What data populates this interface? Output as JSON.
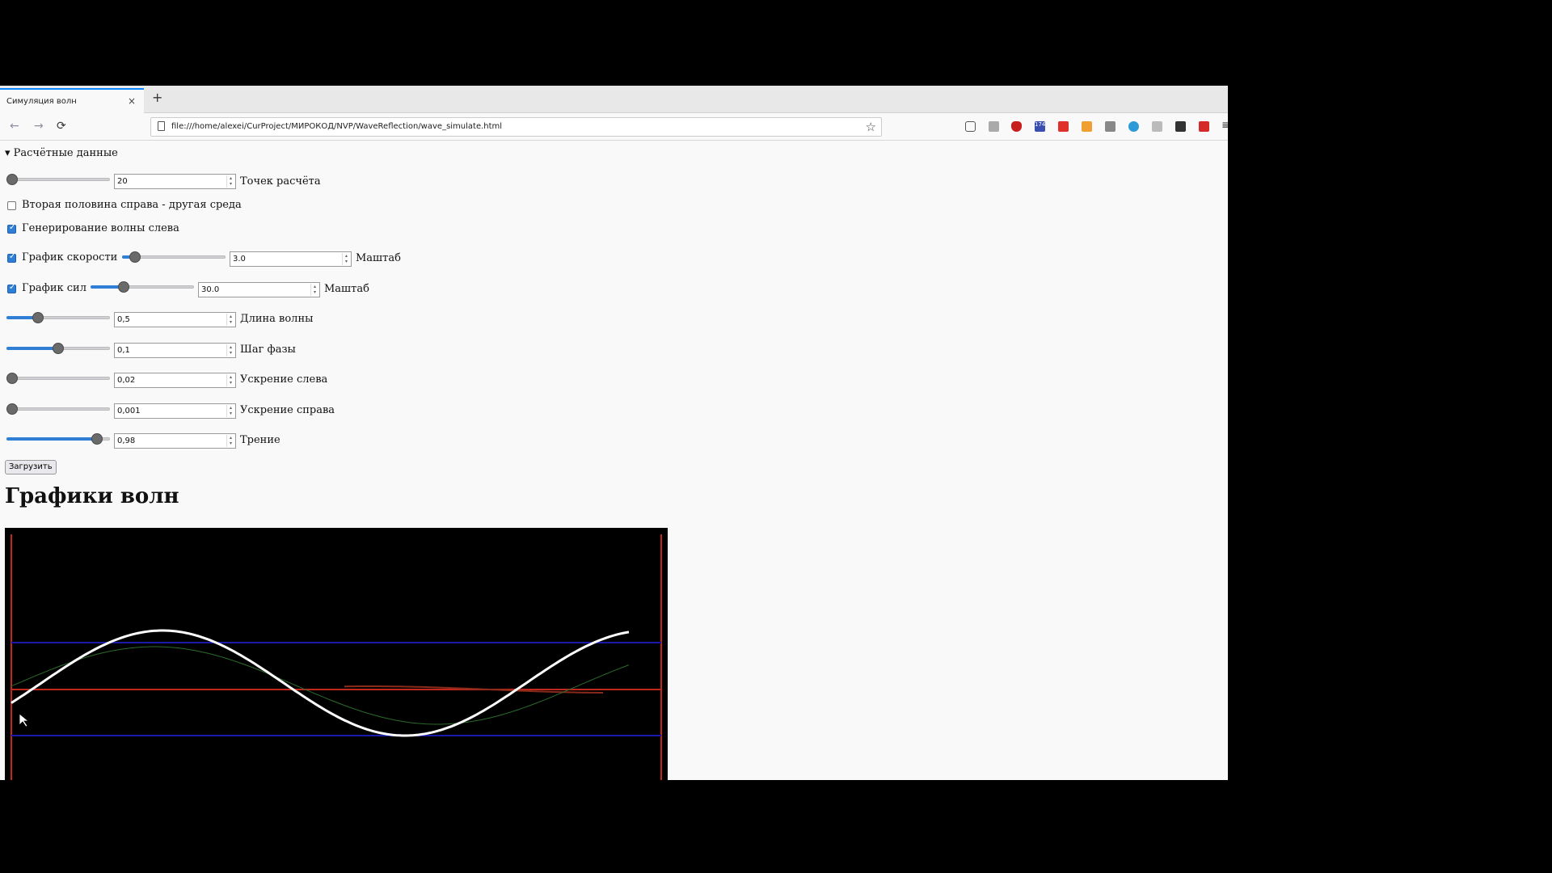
{
  "browser": {
    "tab_title": "Симуляция волн",
    "tab_close": "×",
    "new_tab": "+",
    "url": "file:///home/alexei/CurProject/МИРОКОД/NVP/WaveReflection/wave_simulate.html",
    "back_icon": "←",
    "forward_icon": "→",
    "reload_icon": "⟳",
    "star_icon": "☆",
    "menu_icon": "≡",
    "extension_badge": "174"
  },
  "panel": {
    "summary": "▾ Расчётные данные",
    "points": {
      "value": "20",
      "label": "Точек расчёта",
      "level": 0.0
    },
    "second_half_label": "Вторая половина справа - другая среда",
    "second_half_checked": false,
    "generate_label": "Генерирование волны слева",
    "generate_checked": true,
    "velocity": {
      "label": "График скорости",
      "checked": true,
      "value": "3.0",
      "scale_label": "Маштаб",
      "level": 0.08
    },
    "force": {
      "label": "График сил",
      "checked": true,
      "value": "30.0",
      "scale_label": "Маштаб",
      "level": 0.3
    },
    "wavelength": {
      "value": "0,5",
      "label": "Длина волны",
      "level": 0.28
    },
    "phase_step": {
      "value": "0,1",
      "label": "Шаг фазы",
      "level": 0.5
    },
    "accel_left": {
      "value": "0,02",
      "label": "Ускрение слева",
      "level": 0.0
    },
    "accel_right": {
      "value": "0,001",
      "label": "Ускрение справа",
      "level": 0.0
    },
    "friction": {
      "value": "0,98",
      "label": "Трение",
      "level": 0.92
    },
    "load_button": "Загрузить"
  },
  "heading": "Графики волн",
  "colors": {
    "boundary": "#c0281c",
    "guide": "#1a1aa8",
    "wave": "#ffffff",
    "velocity": "#2b6b2b",
    "force": "#8a2a1a",
    "accent": "#2f7fd6"
  }
}
